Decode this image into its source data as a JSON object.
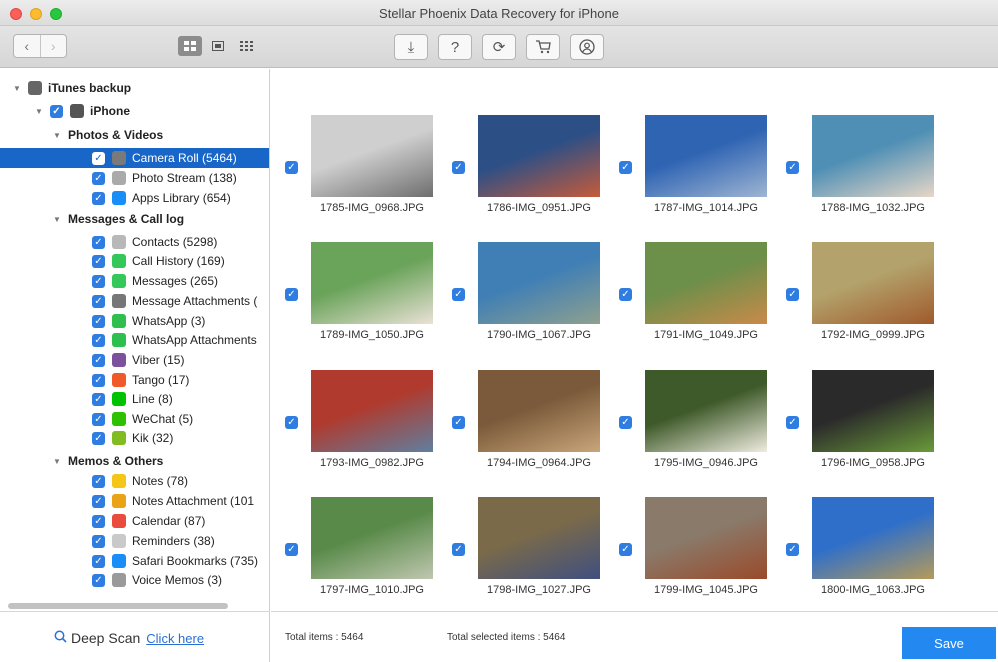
{
  "window": {
    "title": "Stellar Phoenix Data Recovery for iPhone"
  },
  "toolbar": {
    "back": "‹",
    "forward": "›",
    "views": [
      "view-grid-icon",
      "view-list-icon",
      "view-thumbnail-icon"
    ],
    "tools": [
      {
        "name": "download-icon",
        "glyph": "⤓"
      },
      {
        "name": "help-icon",
        "glyph": "?"
      },
      {
        "name": "refresh-icon",
        "glyph": "⟳"
      },
      {
        "name": "cart-icon",
        "glyph": "🛒"
      },
      {
        "name": "user-icon",
        "glyph": "☺"
      }
    ]
  },
  "sidebar": {
    "rows": [
      {
        "label": "iTunes backup",
        "level": 0,
        "arrow": "▼",
        "checkbox": false,
        "icon": "music-icon",
        "icon_color": "#666",
        "bold": true
      },
      {
        "label": "iPhone",
        "level": 1,
        "arrow": "▼",
        "checkbox": true,
        "icon": "phone-icon",
        "icon_color": "#555",
        "bold": true
      },
      {
        "label": "Photos & Videos",
        "level": 2,
        "arrow": "▼",
        "checkbox": false,
        "icon": "",
        "icon_color": "",
        "bold": true
      },
      {
        "label": "Camera Roll (5464)",
        "level": 3,
        "arrow": "",
        "checkbox": true,
        "icon": "camera-icon",
        "icon_color": "#7a7a7a",
        "bold": false,
        "selected": true
      },
      {
        "label": "Photo Stream (138)",
        "level": 3,
        "arrow": "",
        "checkbox": true,
        "icon": "cloud-icon",
        "icon_color": "#aaa",
        "bold": false
      },
      {
        "label": "Apps Library (654)",
        "level": 3,
        "arrow": "",
        "checkbox": true,
        "icon": "appstore-icon",
        "icon_color": "#1a8ef7",
        "bold": false
      },
      {
        "label": "Messages & Call log",
        "level": 2,
        "arrow": "▼",
        "checkbox": false,
        "icon": "",
        "icon_color": "",
        "bold": true
      },
      {
        "label": "Contacts (5298)",
        "level": 3,
        "arrow": "",
        "checkbox": true,
        "icon": "contacts-icon",
        "icon_color": "#b8b8b8",
        "bold": false
      },
      {
        "label": "Call History (169)",
        "level": 3,
        "arrow": "",
        "checkbox": true,
        "icon": "phone-call-icon",
        "icon_color": "#34c759",
        "bold": false
      },
      {
        "label": "Messages (265)",
        "level": 3,
        "arrow": "",
        "checkbox": true,
        "icon": "messages-icon",
        "icon_color": "#34c759",
        "bold": false
      },
      {
        "label": "Message Attachments (",
        "level": 3,
        "arrow": "",
        "checkbox": true,
        "icon": "attachment-icon",
        "icon_color": "#777",
        "bold": false
      },
      {
        "label": "WhatsApp (3)",
        "level": 3,
        "arrow": "",
        "checkbox": true,
        "icon": "whatsapp-icon",
        "icon_color": "#2fbf4f",
        "bold": false
      },
      {
        "label": "WhatsApp Attachments",
        "level": 3,
        "arrow": "",
        "checkbox": true,
        "icon": "whatsapp-icon",
        "icon_color": "#2fbf4f",
        "bold": false
      },
      {
        "label": "Viber (15)",
        "level": 3,
        "arrow": "",
        "checkbox": true,
        "icon": "viber-icon",
        "icon_color": "#7b519d",
        "bold": false
      },
      {
        "label": "Tango (17)",
        "level": 3,
        "arrow": "",
        "checkbox": true,
        "icon": "tango-icon",
        "icon_color": "#f05a28",
        "bold": false
      },
      {
        "label": "Line (8)",
        "level": 3,
        "arrow": "",
        "checkbox": true,
        "icon": "line-icon",
        "icon_color": "#00c300",
        "bold": false
      },
      {
        "label": "WeChat (5)",
        "level": 3,
        "arrow": "",
        "checkbox": true,
        "icon": "wechat-icon",
        "icon_color": "#2dc100",
        "bold": false
      },
      {
        "label": "Kik (32)",
        "level": 3,
        "arrow": "",
        "checkbox": true,
        "icon": "kik-icon",
        "icon_color": "#82bc23",
        "bold": false
      },
      {
        "label": "Memos & Others",
        "level": 2,
        "arrow": "▼",
        "checkbox": false,
        "icon": "",
        "icon_color": "",
        "bold": true
      },
      {
        "label": "Notes (78)",
        "level": 3,
        "arrow": "",
        "checkbox": true,
        "icon": "notes-icon",
        "icon_color": "#f5c518",
        "bold": false
      },
      {
        "label": "Notes Attachment (101",
        "level": 3,
        "arrow": "",
        "checkbox": true,
        "icon": "notes-attachment-icon",
        "icon_color": "#e8a317",
        "bold": false
      },
      {
        "label": "Calendar (87)",
        "level": 3,
        "arrow": "",
        "checkbox": true,
        "icon": "calendar-icon",
        "icon_color": "#e94b3c",
        "bold": false
      },
      {
        "label": "Reminders (38)",
        "level": 3,
        "arrow": "",
        "checkbox": true,
        "icon": "reminders-icon",
        "icon_color": "#c9c9c9",
        "bold": false
      },
      {
        "label": "Safari Bookmarks (735)",
        "level": 3,
        "arrow": "",
        "checkbox": true,
        "icon": "safari-icon",
        "icon_color": "#1a8ef7",
        "bold": false
      },
      {
        "label": "Voice Memos (3)",
        "level": 3,
        "arrow": "",
        "checkbox": true,
        "icon": "voice-memo-icon",
        "icon_color": "#9a9a9a",
        "bold": false
      }
    ],
    "deep_scan_label": "Deep Scan",
    "deep_scan_link": "Click here"
  },
  "grid": {
    "items": [
      {
        "name": "1785-IMG_0968.JPG",
        "colors": [
          "#cfcfcf",
          "#6e6e6e"
        ]
      },
      {
        "name": "1786-IMG_0951.JPG",
        "colors": [
          "#2c4f86",
          "#c65b3a"
        ]
      },
      {
        "name": "1787-IMG_1014.JPG",
        "colors": [
          "#2f64b3",
          "#9fb5d2"
        ]
      },
      {
        "name": "1788-IMG_1032.JPG",
        "colors": [
          "#4f8fb5",
          "#e7d7c7"
        ]
      },
      {
        "name": "1789-IMG_1050.JPG",
        "colors": [
          "#6aa35a",
          "#eae1d6"
        ]
      },
      {
        "name": "1790-IMG_1067.JPG",
        "colors": [
          "#3f7fb5",
          "#8fa08f"
        ]
      },
      {
        "name": "1791-IMG_1049.JPG",
        "colors": [
          "#6c8f4a",
          "#c98a4a"
        ]
      },
      {
        "name": "1792-IMG_0999.JPG",
        "colors": [
          "#b3a26b",
          "#a05a2c"
        ]
      },
      {
        "name": "1793-IMG_0982.JPG",
        "colors": [
          "#b03a2e",
          "#5f7f9f"
        ]
      },
      {
        "name": "1794-IMG_0964.JPG",
        "colors": [
          "#7a5a3a",
          "#c9a57a"
        ]
      },
      {
        "name": "1795-IMG_0946.JPG",
        "colors": [
          "#3f5a2a",
          "#efece0"
        ]
      },
      {
        "name": "1796-IMG_0958.JPG",
        "colors": [
          "#2a2a2a",
          "#6a9a3a"
        ]
      },
      {
        "name": "1797-IMG_1010.JPG",
        "colors": [
          "#5a8a4a",
          "#bfc7b0"
        ]
      },
      {
        "name": "1798-IMG_1027.JPG",
        "colors": [
          "#7a6a4a",
          "#3f4f7f"
        ]
      },
      {
        "name": "1799-IMG_1045.JPG",
        "colors": [
          "#8a7a6a",
          "#9a4a2a"
        ]
      },
      {
        "name": "1800-IMG_1063.JPG",
        "colors": [
          "#2f6fc9",
          "#b59a5a"
        ]
      }
    ]
  },
  "footer": {
    "total_items": "Total items : 5464",
    "total_selected": "Total selected items : 5464",
    "save": "Save"
  },
  "colors": {
    "accent": "#2389f0",
    "selection": "#1766c8",
    "checkbox": "#2f7de1"
  }
}
